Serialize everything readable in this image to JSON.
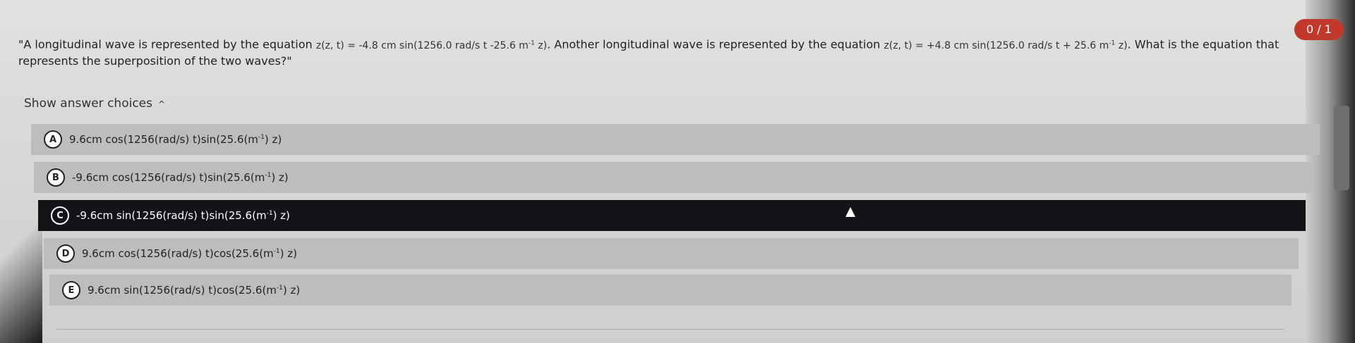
{
  "score": "0 / 1",
  "question": {
    "open_quote": "\"A longitudinal wave is represented by the equation ",
    "eq1_pre": "z(z, t) = -4.8 cm sin(1256.0 rad/s t -25.6 m",
    "eq1_sup": "-1",
    "eq1_post": " z)",
    "middle": ". Another longitudinal wave is represented by the equation ",
    "eq2_pre": "z(z, t) = +4.8 cm sin(1256.0 rad/s t + 25.6 m",
    "eq2_sup": "-1",
    "eq2_post": " z)",
    "ending": ". What is the equation that represents the superposition of the two waves?\""
  },
  "show_choices_label": "Show answer choices",
  "caret": "^",
  "choices": [
    {
      "letter": "A",
      "pre": "9.6cm cos(1256(rad/s) t)sin(25.6(m",
      "sup": "-1",
      "post": ") z)"
    },
    {
      "letter": "B",
      "pre": "-9.6cm cos(1256(rad/s) t)sin(25.6(m",
      "sup": "-1",
      "post": ") z)"
    },
    {
      "letter": "C",
      "pre": "-9.6cm sin(1256(rad/s) t)sin(25.6(m",
      "sup": "-1",
      "post": ") z)"
    },
    {
      "letter": "D",
      "pre": "9.6cm cos(1256(rad/s) t)cos(25.6(m",
      "sup": "-1",
      "post": ") z)"
    },
    {
      "letter": "E",
      "pre": "9.6cm sin(1256(rad/s) t)cos(25.6(m",
      "sup": "-1",
      "post": ") z)"
    }
  ],
  "selected_choice": "C",
  "colors": {
    "score_badge": "#c0392b",
    "selected_bg": "#121418",
    "choice_bg": "#bdbdbb"
  }
}
